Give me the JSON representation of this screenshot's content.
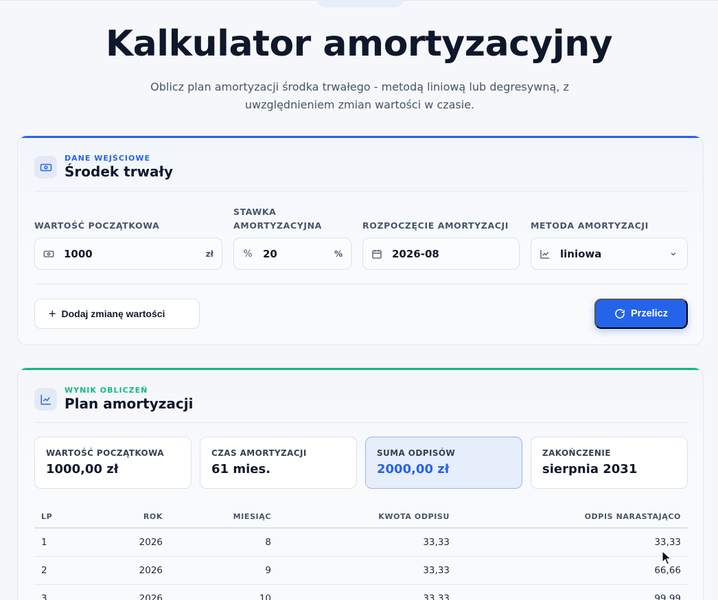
{
  "page": {
    "title": "Kalkulator amortyzacyjny",
    "subtitle": "Oblicz plan amortyzacji środka trwałego - metodą liniową lub degresywną, z uwzględnieniem zmian wartości w czasie."
  },
  "input_card": {
    "eyebrow": "DANE WEJŚCIOWE",
    "title": "Środek trwały",
    "fields": {
      "initial_value": {
        "label": "WARTOŚĆ POCZĄTKOWA",
        "value": "1000",
        "suffix": "zł"
      },
      "rate": {
        "label": "STAWKA AMORTYZACYJNA",
        "value": "20",
        "prefix": "%",
        "suffix": "%"
      },
      "start": {
        "label": "ROZPOCZĘCIE AMORTYZACJI",
        "value": "2026-08"
      },
      "method": {
        "label": "METODA AMORTYZACJI",
        "value": "liniowa"
      }
    },
    "add_change_label": "Dodaj zmianę wartości",
    "recalc_label": "Przelicz"
  },
  "result_card": {
    "eyebrow": "WYNIK OBLICZEŃ",
    "title": "Plan amortyzacji",
    "stats": [
      {
        "label": "WARTOŚĆ POCZĄTKOWA",
        "value": "1000,00 zł"
      },
      {
        "label": "CZAS AMORTYZACJI",
        "value": "61 mies."
      },
      {
        "label": "SUMA ODPISÓW",
        "value": "2000,00 zł"
      },
      {
        "label": "ZAKOŃCZENIE",
        "value": "sierpnia 2031"
      }
    ],
    "table": {
      "headers": [
        "LP",
        "ROK",
        "MIESIĄC",
        "KWOTA ODPISU",
        "ODPIS NARASTAJĄCO"
      ],
      "rows": [
        [
          "1",
          "2026",
          "8",
          "33,33",
          "33,33"
        ],
        [
          "2",
          "2026",
          "9",
          "33,33",
          "66,66"
        ],
        [
          "3",
          "2026",
          "10",
          "33,33",
          "99,99"
        ]
      ]
    }
  },
  "colors": {
    "accent": "#2563eb",
    "success": "#10b981",
    "text": "#0f172a",
    "muted": "#475569"
  }
}
